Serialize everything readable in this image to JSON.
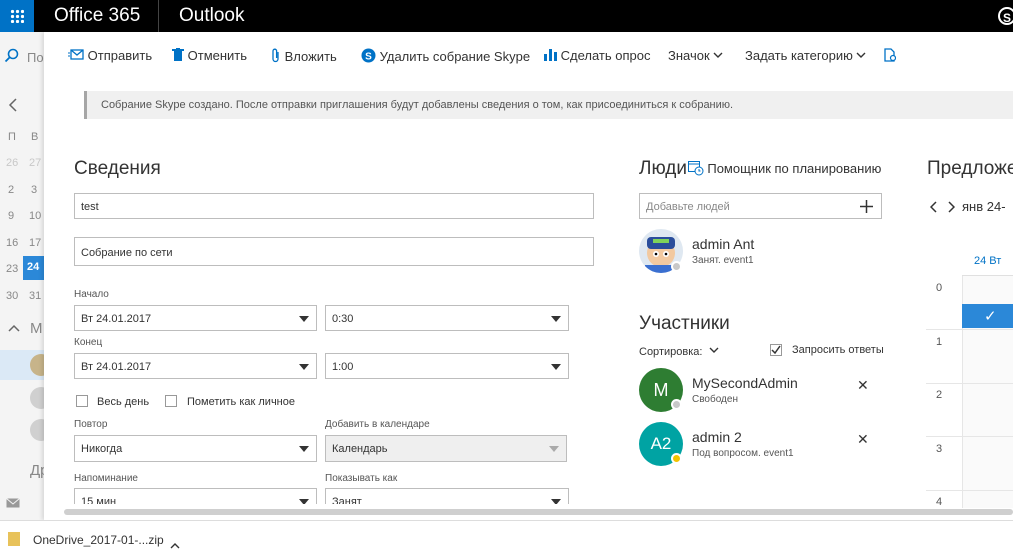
{
  "topbar": {
    "brand": "Office 365",
    "app": "Outlook",
    "skype_glyph": "S"
  },
  "left_rail": {
    "search_fragment": "По",
    "weekday_labels": [
      "П",
      "В"
    ],
    "week_rows": [
      [
        "26",
        "27"
      ],
      [
        "2",
        "3"
      ],
      [
        "9",
        "10"
      ],
      [
        "16",
        "17"
      ],
      [
        "23",
        "24"
      ],
      [
        "30",
        "31"
      ]
    ],
    "group_label_fragment": "М",
    "bottom_fragment": "Др"
  },
  "toolbar": {
    "send": "Отправить",
    "discard": "Отменить",
    "attach": "Вложить",
    "delete_skype": "Удалить собрание Skype",
    "poll": "Сделать опрос",
    "badge": "Значок",
    "category": "Задать категорию"
  },
  "infobar": {
    "text": "Собрание Skype создано. После отправки приглашения будут добавлены сведения о том, как присоединиться к собранию."
  },
  "details": {
    "title": "Сведения",
    "subject_value": "test",
    "location_value": "Собрание по сети",
    "start_label": "Начало",
    "start_date": "Вт 24.01.2017",
    "start_time": "0:30",
    "end_label": "Конец",
    "end_date": "Вт 24.01.2017",
    "end_time": "1:00",
    "all_day_label": "Весь день",
    "private_label": "Пометить как личное",
    "repeat_label": "Повтор",
    "repeat_value": "Никогда",
    "add_to_cal_label": "Добавить в календаре",
    "add_to_cal_value": "Календарь",
    "reminder_label": "Напоминание",
    "reminder_value": "15 мин",
    "show_as_label": "Показывать как",
    "show_as_value": "Занят"
  },
  "people": {
    "title": "Люди",
    "scheduler_label": "Помощник по планированию",
    "add_placeholder": "Добавьте людей",
    "organizer": {
      "name": "admin Ant",
      "status": "Занят. event1"
    },
    "attendees_title": "Участники",
    "sort_label": "Сортировка:",
    "request_responses_label": "Запросить ответы",
    "request_responses_checked": true,
    "attendees": [
      {
        "initials": "M",
        "name": "MySecondAdmin",
        "status": "Свободен",
        "color": "#2e7d32",
        "presence": "#c8c8c8"
      },
      {
        "initials": "A2",
        "name": "admin 2",
        "status": "Под вопросом. event1",
        "color": "#00a3a3",
        "presence": "#f3c300"
      }
    ]
  },
  "suggestions": {
    "title_fragment": "Предложе",
    "date_range_fragment": "янв 24-",
    "day_header": "24 Вт",
    "hours": [
      "0",
      "1",
      "2",
      "3",
      "4"
    ],
    "check_glyph": "✓"
  },
  "downloads": {
    "file_fragment": "OneDrive_2017-01-...zip"
  },
  "colors": {
    "accent": "#0072c6",
    "selected_day": "#2b88d8"
  }
}
